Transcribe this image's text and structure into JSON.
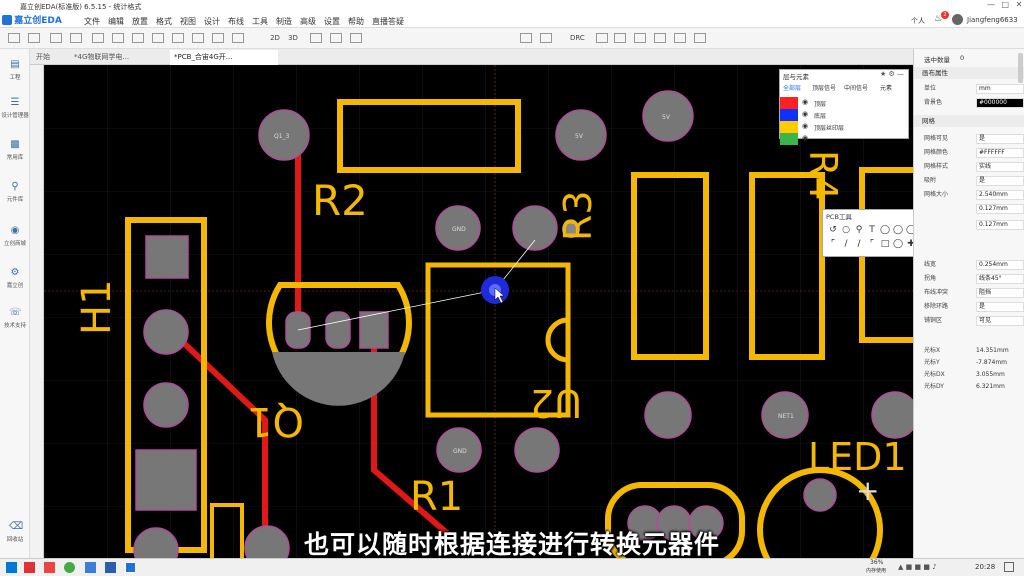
{
  "titlebar": {
    "title": "嘉立创EDA(标准版) 6.5.15 - 统计格式",
    "logo": "嘉立创EDA",
    "logo_suffix": "标准",
    "menus": [
      "文件",
      "编辑",
      "放置",
      "格式",
      "视图",
      "设计",
      "布线",
      "工具",
      "制造",
      "高级",
      "设置",
      "帮助",
      "直播答疑"
    ],
    "user_label": "个人",
    "notification_count": "2",
    "username": "Jiangfeng6633"
  },
  "toolbar": {
    "items": [
      "2D",
      "3D",
      "DRC"
    ]
  },
  "left_panel": {
    "items": [
      "工程",
      "设计管理器",
      "常用库",
      "元件库",
      "立创商城",
      "嘉立创",
      "技术支持",
      "回收站"
    ]
  },
  "tabs": [
    "开始",
    "*4G物联网学电...",
    "*PCB_合宙4G开..."
  ],
  "right_panel": {
    "selected_count_label": "选中数量",
    "selected_count": "0",
    "sections": {
      "canvas_props": "画布属性",
      "grid": "网格"
    },
    "rows": [
      {
        "label": "单位",
        "value": "mm"
      },
      {
        "label": "背景色",
        "value": "#000000"
      },
      {
        "label": "网格可见",
        "value": "是"
      },
      {
        "label": "网格颜色",
        "value": "#FFFFFF"
      },
      {
        "label": "网格样式",
        "value": "实线"
      },
      {
        "label": "吸附",
        "value": "是"
      },
      {
        "label": "网格大小",
        "value": "2.540mm"
      },
      {
        "label": "",
        "value": "0.127mm"
      },
      {
        "label": "",
        "value": "0.127mm"
      },
      {
        "label": "线宽",
        "value": "0.254mm"
      },
      {
        "label": "拐角",
        "value": "线条45°"
      },
      {
        "label": "布线冲突",
        "value": "阻挡"
      },
      {
        "label": "移除环路",
        "value": "是"
      },
      {
        "label": "铺铜区",
        "value": "可见"
      }
    ],
    "coords": [
      {
        "label": "光标X",
        "value": "14.351mm"
      },
      {
        "label": "光标Y",
        "value": "-7.874mm"
      },
      {
        "label": "光标DX",
        "value": "3.055mm"
      },
      {
        "label": "光标DY",
        "value": "6.321mm"
      }
    ]
  },
  "layer_panel": {
    "title": "层与元素",
    "tabs": [
      "全部层",
      "顶层信号",
      "中间信号",
      "元素"
    ],
    "layers": [
      {
        "name": "顶层",
        "color": "#ff2020"
      },
      {
        "name": "底层",
        "color": "#1030ff"
      },
      {
        "name": "顶层丝印层",
        "color": "#ffcc00"
      },
      {
        "name": "",
        "color": "#39b54a"
      }
    ]
  },
  "pcb_tools": {
    "title": "PCB工具"
  },
  "canvas": {
    "labels": {
      "R2": "R2",
      "R3": "R3",
      "R4": "R4",
      "H1": "H1",
      "Q1": "Q1",
      "U2": "U2",
      "R1": "R1",
      "LED1": "LED1"
    },
    "pads": {
      "q1_3": "Q1_3",
      "v5a": "5V",
      "v5b": "5V",
      "gnd1": "GND",
      "gnd2": "GND",
      "net1": "NET1"
    }
  },
  "subtitle": "也可以随时根据连接进行转换元器件",
  "taskbar": {
    "memory_percent": "36%",
    "memory_label": "内存使用",
    "time": "20:28"
  }
}
